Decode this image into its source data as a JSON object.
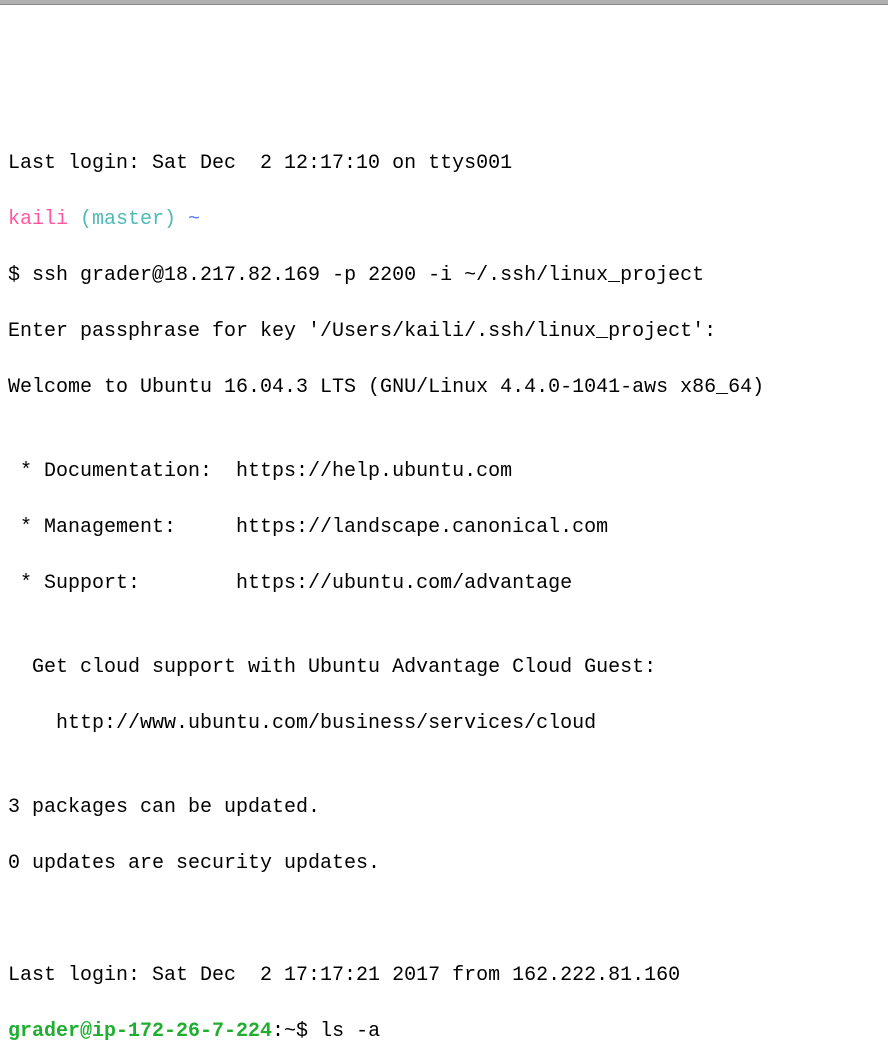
{
  "terminal": {
    "last_login_local": "Last login: Sat Dec  2 12:17:10 on ttys001",
    "ps1_user": "kaili ",
    "ps1_branch": "(master) ",
    "ps1_path": "~",
    "local_prompt": "$ ",
    "ssh_cmd": "ssh grader@18.217.82.169 -p 2200 -i ~/.ssh/linux_project",
    "passphrase_prompt": "Enter passphrase for key '/Users/kaili/.ssh/linux_project':",
    "welcome": "Welcome to Ubuntu 16.04.3 LTS (GNU/Linux 4.4.0-1041-aws x86_64)",
    "blank1": "",
    "doc_line": " * Documentation:  https://help.ubuntu.com",
    "mgmt_line": " * Management:     https://landscape.canonical.com",
    "support_line": " * Support:        https://ubuntu.com/advantage",
    "blank2": "",
    "cloud_line1": "  Get cloud support with Ubuntu Advantage Cloud Guest:",
    "cloud_line2": "    http://www.ubuntu.com/business/services/cloud",
    "blank3": "",
    "updates_line1": "3 packages can be updated.",
    "updates_line2": "0 updates are security updates.",
    "blank4": "",
    "blank5": "",
    "last_login_remote": "Last login: Sat Dec  2 17:17:21 2017 from 162.222.81.160",
    "remote_ps1_userhost": "grader@ip-172-26-7-224",
    "remote_ps1_sep": ":~$ ",
    "remote_cmd": "ls -a"
  }
}
